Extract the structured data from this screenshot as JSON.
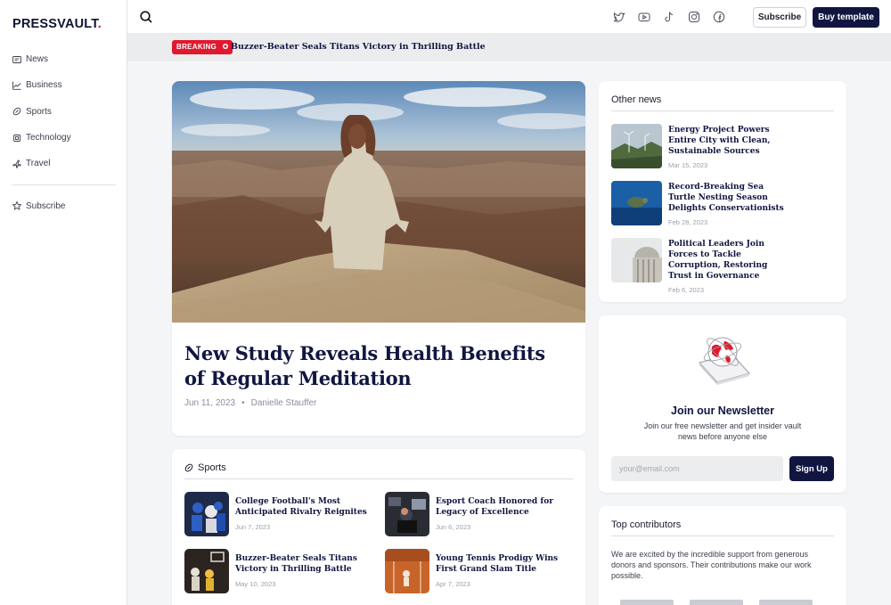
{
  "brand": {
    "name": "PRESSVAULT",
    "dot": ".",
    "accent": "#e0192f",
    "navy": "#111641"
  },
  "sidebar": {
    "items": [
      {
        "label": "News",
        "icon": "newspaper-icon"
      },
      {
        "label": "Business",
        "icon": "trend-chart-icon"
      },
      {
        "label": "Sports",
        "icon": "football-icon"
      },
      {
        "label": "Technology",
        "icon": "chip-icon"
      },
      {
        "label": "Travel",
        "icon": "plane-icon"
      }
    ],
    "subscribe": {
      "label": "Subscribe",
      "icon": "star-icon"
    }
  },
  "topbar": {
    "socials": [
      "twitter-icon",
      "youtube-icon",
      "tiktok-icon",
      "instagram-icon",
      "facebook-icon"
    ],
    "subscribe_label": "Subscribe",
    "buy_label": "Buy template"
  },
  "breaking": {
    "badge": "BREAKING",
    "headline": "Buzzer-Beater Seals Titans Victory in Thrilling Battle"
  },
  "hero": {
    "title": "New Study Reveals Health Benefits of Regular Meditation",
    "date": "Jun 11, 2023",
    "separator": "•",
    "author": "Danielle Stauffer"
  },
  "sports": {
    "heading": "Sports",
    "items": [
      {
        "title": "College Football's Most Anticipated Rivalry Reignites",
        "date": "Jun 7, 2023"
      },
      {
        "title": "Esport Coach Honored for Legacy of Excellence",
        "date": "Jun 6, 2023"
      },
      {
        "title": "Buzzer-Beater Seals Titans Victory in Thrilling Battle",
        "date": "May 10, 2023"
      },
      {
        "title": "Young Tennis Prodigy Wins First Grand Slam Title",
        "date": "Apr 7, 2023"
      }
    ]
  },
  "other_news": {
    "heading": "Other news",
    "items": [
      {
        "title": "Energy Project Powers Entire City with Clean, Sustainable Sources",
        "date": "Mar 15, 2023"
      },
      {
        "title": "Record-Breaking Sea Turtle Nesting Season Delights Conservationists",
        "date": "Feb 28, 2023"
      },
      {
        "title": "Political Leaders Join Forces to Tackle Corruption, Restoring Trust in Governance",
        "date": "Feb 6, 2023"
      }
    ]
  },
  "newsletter": {
    "title": "Join our Newsletter",
    "description": "Join our free newsletter and get insider vault news before anyone else",
    "placeholder": "your@email.com",
    "button": "Sign Up"
  },
  "contributors": {
    "heading": "Top contributors",
    "description": "We are excited by the incredible support from generous donors and sponsors. Their contributions make our work possible."
  }
}
